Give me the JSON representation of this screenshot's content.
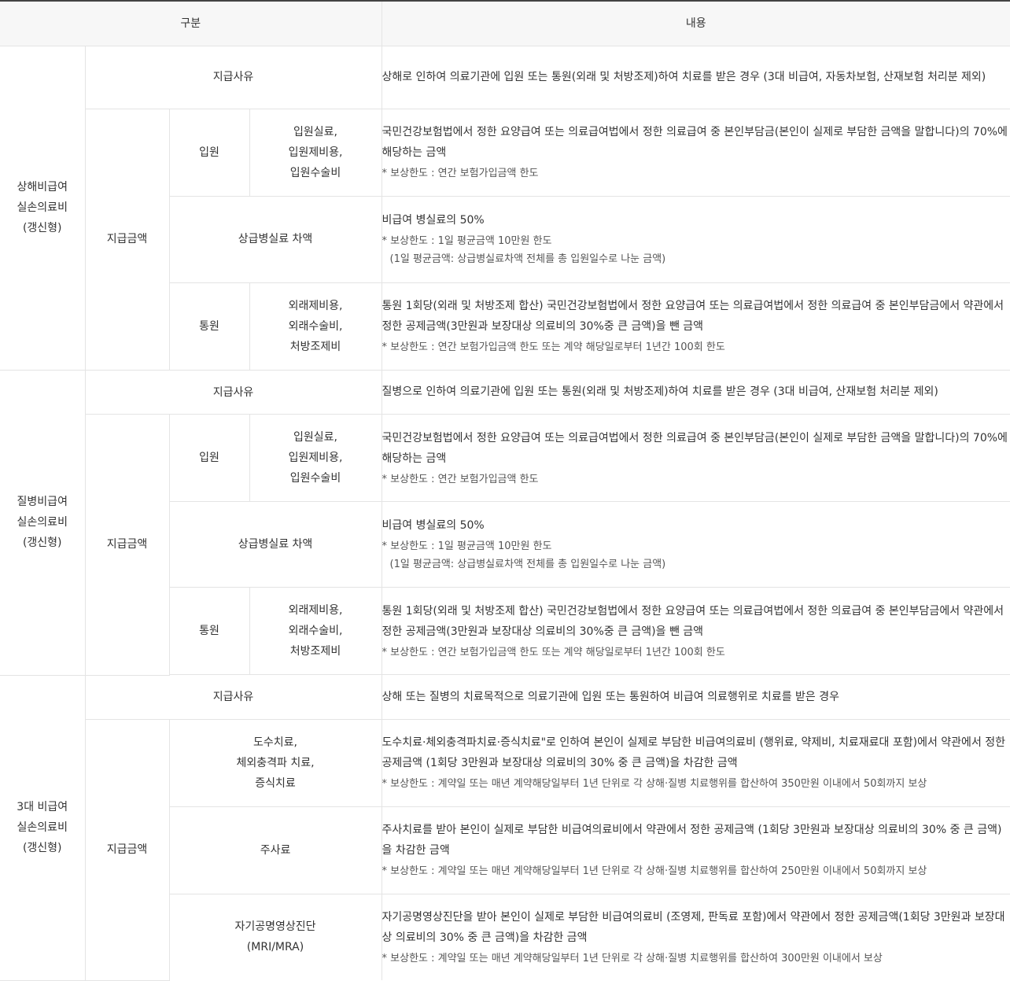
{
  "header": {
    "col1": "구분",
    "col2": "내용"
  },
  "sections": [
    {
      "title": "상해비급여\n실손의료비\n(갱신형)",
      "reason_label": "지급사유",
      "reason_text": "상해로 인하여 의료기관에 입원 또는 통원(외래 및 처방조제)하여 치료를 받은 경우 (3대 비급여, 자동차보험, 산재보험 처리분 제외)",
      "payment_label": "지급금액",
      "rows": [
        {
          "type": "입원",
          "item": "입원실료,\n입원제비용,\n입원수술비",
          "main": "국민건강보험법에서 정한 요양급여 또는 의료급여법에서 정한 의료급여 중 본인부담금(본인이 실제로 부담한 금액을 말합니다)의 70%에 해당하는 금액",
          "note": "* 보상한도 : 연간 보험가입금액 한도",
          "note2": ""
        },
        {
          "type": "",
          "item": "상급병실료 차액",
          "main": "비급여 병실료의 50%",
          "note": "* 보상한도 : 1일 평균금액 10만원 한도",
          "note2": "(1일 평균금액: 상급병실료차액 전체를 총 입원일수로 나눈 금액)"
        },
        {
          "type": "통원",
          "item": "외래제비용,\n외래수술비,\n처방조제비",
          "main": "통원 1회당(외래 및 처방조제 합산) 국민건강보험법에서 정한 요양급여 또는 의료급여법에서 정한 의료급여 중 본인부담금에서 약관에서 정한 공제금액(3만원과 보장대상 의료비의 30%중 큰 금액)을 뺀 금액",
          "note": "* 보상한도 : 연간 보험가입금액 한도 또는 계약 해당일로부터 1년간 100회 한도",
          "note2": ""
        }
      ]
    },
    {
      "title": "질병비급여\n실손의료비\n(갱신형)",
      "reason_label": "지급사유",
      "reason_text": "질병으로 인하여 의료기관에 입원 또는 통원(외래 및 처방조제)하여 치료를 받은 경우 (3대 비급여, 산재보험 처리분 제외)",
      "payment_label": "지급금액",
      "rows": [
        {
          "type": "입원",
          "item": "입원실료,\n입원제비용,\n입원수술비",
          "main": "국민건강보험법에서 정한 요양급여 또는 의료급여법에서 정한 의료급여 중 본인부담금(본인이 실제로 부담한 금액을 말합니다)의 70%에 해당하는 금액",
          "note": "* 보상한도 : 연간 보험가입금액 한도",
          "note2": ""
        },
        {
          "type": "",
          "item": "상급병실료 차액",
          "main": "비급여 병실료의 50%",
          "note": "* 보상한도 : 1일 평균금액 10만원 한도",
          "note2": "(1일 평균금액: 상급병실료차액 전체를 총 입원일수로 나눈 금액)"
        },
        {
          "type": "통원",
          "item": "외래제비용,\n외래수술비,\n처방조제비",
          "main": "통원 1회당(외래 및 처방조제 합산) 국민건강보험법에서 정한 요양급여 또는 의료급여법에서 정한 의료급여 중 본인부담금에서 약관에서 정한 공제금액(3만원과 보장대상 의료비의 30%중 큰 금액)을 뺀 금액",
          "note": "* 보상한도 : 연간 보험가입금액 한도 또는 계약 해당일로부터 1년간 100회 한도",
          "note2": ""
        }
      ]
    },
    {
      "title": "3대 비급여\n실손의료비\n(갱신형)",
      "reason_label": "지급사유",
      "reason_text": "상해 또는 질병의 치료목적으로 의료기관에 입원 또는 통원하여 비급여 의료행위로 치료를 받은 경우",
      "payment_label": "지급금액",
      "rows": [
        {
          "item": "도수치료,\n체외충격파 치료,\n증식치료",
          "main": "도수치료·체외충격파치료·증식치료\"로 인하여 본인이 실제로 부담한 비급여의료비 (행위료, 약제비, 치료재료대 포함)에서 약관에서 정한 공제금액 (1회당 3만원과 보장대상 의료비의 30% 중 큰 금액)을 차감한 금액",
          "note": "* 보상한도 : 계약일 또는 매년 계약해당일부터 1년 단위로 각 상해·질병 치료행위를 합산하여 350만원 이내에서 50회까지 보상"
        },
        {
          "item": "주사료",
          "main": "주사치료를 받아 본인이 실제로 부담한 비급여의료비에서 약관에서 정한 공제금액 (1회당 3만원과 보장대상 의료비의 30% 중 큰 금액)을 차감한 금액",
          "note": "* 보상한도 : 계약일 또는 매년 계약해당일부터 1년 단위로 각 상해·질병 치료행위를 합산하여 250만원 이내에서 50회까지 보상"
        },
        {
          "item": "자기공명영상진단\n(MRI/MRA)",
          "main": "자기공명영상진단을 받아 본인이 실제로 부담한 비급여의료비 (조영제, 판독료 포함)에서 약관에서 정한 공제금액(1회당 3만원과 보장대상 의료비의 30% 중 큰 금액)을 차감한 금액",
          "note": "* 보상한도 : 계약일 또는 매년 계약해당일부터 1년 단위로 각 상해·질병 치료행위를 합산하여 300만원 이내에서 보상"
        }
      ]
    }
  ]
}
